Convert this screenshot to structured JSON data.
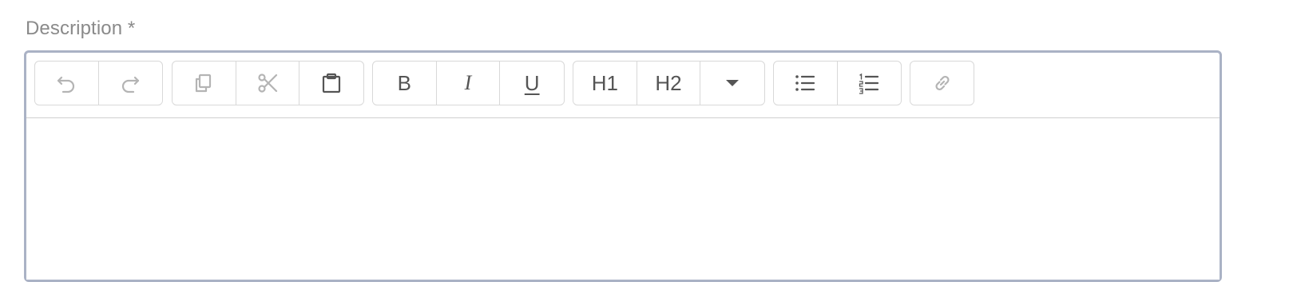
{
  "field": {
    "label": "Description *"
  },
  "toolbar": {
    "groups": [
      {
        "name": "history",
        "buttons": [
          {
            "icon": "undo-icon",
            "state": "disabled"
          },
          {
            "icon": "redo-icon",
            "state": "disabled"
          }
        ]
      },
      {
        "name": "clipboard",
        "buttons": [
          {
            "icon": "copy-icon",
            "state": "disabled"
          },
          {
            "icon": "cut-icon",
            "state": "disabled"
          },
          {
            "icon": "paste-icon",
            "state": "enabled"
          }
        ]
      },
      {
        "name": "formatting",
        "buttons": [
          {
            "icon": "bold-icon",
            "label": "B",
            "state": "enabled"
          },
          {
            "icon": "italic-icon",
            "label": "I",
            "state": "enabled"
          },
          {
            "icon": "underline-icon",
            "label": "U",
            "state": "enabled"
          }
        ]
      },
      {
        "name": "headings",
        "buttons": [
          {
            "icon": "heading-1-icon",
            "label": "H1",
            "state": "enabled"
          },
          {
            "icon": "heading-2-icon",
            "label": "H2",
            "state": "enabled"
          },
          {
            "icon": "caret-down-icon",
            "state": "enabled"
          }
        ]
      },
      {
        "name": "lists",
        "buttons": [
          {
            "icon": "bulleted-list-icon",
            "state": "enabled"
          },
          {
            "icon": "numbered-list-icon",
            "state": "enabled"
          }
        ]
      },
      {
        "name": "link",
        "buttons": [
          {
            "icon": "link-icon",
            "state": "disabled"
          }
        ]
      }
    ]
  },
  "colors": {
    "editor_border": "#aab2c5",
    "label_text": "#8a8a8a",
    "icon_enabled": "#555555",
    "icon_disabled": "#b4b4b4"
  },
  "editor": {
    "content": ""
  }
}
